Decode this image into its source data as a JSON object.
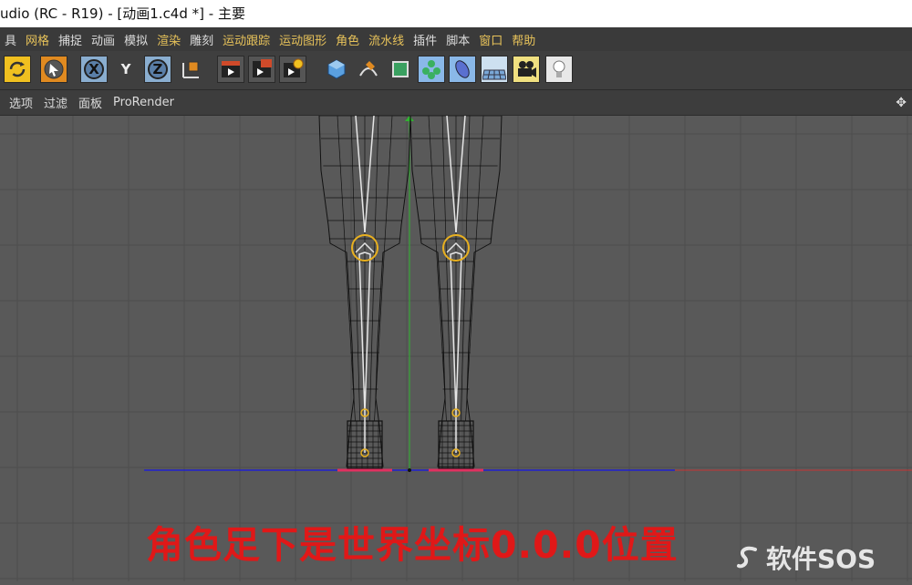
{
  "window": {
    "title": "udio (RC - R19) - [动画1.c4d *] - 主要"
  },
  "menu": [
    {
      "label": "具"
    },
    {
      "label": "网格",
      "hl": true
    },
    {
      "label": "捕捉"
    },
    {
      "label": "动画"
    },
    {
      "label": "模拟"
    },
    {
      "label": "渲染",
      "hl": true
    },
    {
      "label": "雕刻"
    },
    {
      "label": "运动跟踪",
      "hl": true
    },
    {
      "label": "运动图形",
      "hl": true
    },
    {
      "label": "角色",
      "hl": true
    },
    {
      "label": "流水线",
      "hl": true
    },
    {
      "label": "插件"
    },
    {
      "label": "脚本"
    },
    {
      "label": "窗口",
      "hl": true
    },
    {
      "label": "帮助",
      "hl": true
    }
  ],
  "toolbar": {
    "axis_x": "X",
    "axis_y": "Y",
    "axis_z": "Z",
    "icons": [
      "rotate-icon",
      "select-arrow-icon",
      "x-axis-icon",
      "y-axis-icon",
      "z-axis-icon",
      "coordinate-system-icon",
      "render-view-icon",
      "render-picture-viewer-icon",
      "render-settings-icon",
      "cube-icon",
      "pen-spline-icon",
      "subdivision-icon",
      "array-icon",
      "deformer-icon",
      "floor-icon",
      "camera-icon",
      "light-icon"
    ]
  },
  "viewport_menu": [
    {
      "label": "选项"
    },
    {
      "label": "过滤"
    },
    {
      "label": "面板"
    },
    {
      "label": "ProRender"
    }
  ],
  "caption": "角色足下是世界坐标0.0.0位置",
  "watermark": "软件SOS",
  "colors": {
    "grid_line": "#4d4d4d",
    "x_axis": "#c83232",
    "y_axis": "#2fb52f",
    "z_axis": "#2020d0",
    "caption": "#e01818",
    "joint": "#e8b020",
    "wire": "#111111",
    "bone": "#e6e6e6"
  }
}
